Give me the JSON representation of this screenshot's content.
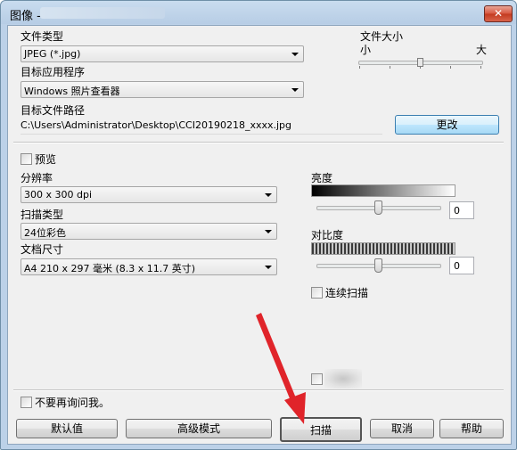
{
  "window": {
    "title": "图像 -",
    "close_label": "✕"
  },
  "file_type": {
    "label": "文件类型",
    "value": "JPEG (*.jpg)"
  },
  "file_size": {
    "label": "文件大小",
    "min_label": "小",
    "max_label": "大",
    "level": 0.5
  },
  "target_app": {
    "label": "目标应用程序",
    "value": "Windows 照片查看器"
  },
  "target_path": {
    "label": "目标文件路径",
    "value": "C:\\Users\\Administrator\\Desktop\\CCI20190218_xxxx.jpg",
    "change_label": "更改"
  },
  "preview": {
    "label": "预览",
    "checked": false
  },
  "resolution": {
    "label": "分辨率",
    "value": "300 x 300 dpi"
  },
  "scan_type": {
    "label": "扫描类型",
    "value": "24位彩色"
  },
  "doc_size": {
    "label": "文档尺寸",
    "value": "A4 210 x 297 毫米 (8.3 x 11.7 英寸)"
  },
  "brightness": {
    "label": "亮度",
    "value": "0",
    "level": 0.5
  },
  "contrast": {
    "label": "对比度",
    "value": "0",
    "level": 0.5
  },
  "continuous_scan": {
    "label": "连续扫描",
    "checked": false
  },
  "dont_ask": {
    "label": "不要再询问我。",
    "checked": false
  },
  "buttons": {
    "default": "默认值",
    "advanced": "高级模式",
    "scan": "扫描",
    "cancel": "取消",
    "help": "帮助"
  },
  "colors": {
    "arrow": "#e0242a",
    "focus_border": "#3c7fb1"
  }
}
